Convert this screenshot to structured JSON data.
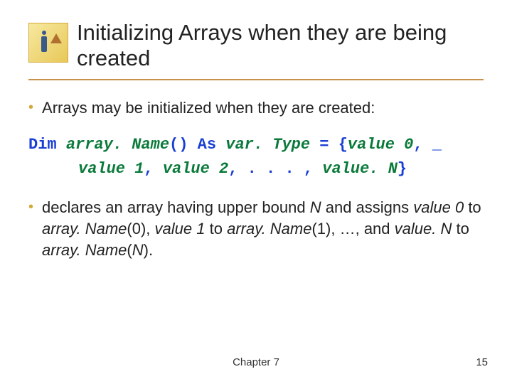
{
  "header": {
    "title": "Initializing Arrays when they are being created"
  },
  "bullets": {
    "intro": "Arrays may be initialized when they are created:",
    "desc_parts": {
      "p1": "declares an array having upper bound ",
      "n1": "N",
      "p2": " and assigns ",
      "v0": "value 0",
      "p3": " to ",
      "a0a": "array. Name",
      "a0b": "(0), ",
      "v1": "value 1",
      "p4": " to ",
      "a1a": "array. Name",
      "a1b": "(1), …, and ",
      "vn": "value. N",
      "p5": " to ",
      "ana": "array. Name",
      "anb": "(",
      "n2": "N",
      "p6": ")."
    }
  },
  "code": {
    "dim": "Dim ",
    "arrname": "array. Name",
    "paren": "() ",
    "as": "As ",
    "vartype": "var. Type",
    "eq": " = {",
    "v0": "value 0",
    "comma": ", ",
    "cont": "_",
    "v1": "value 1",
    "v2": "value 2",
    "dots": ". . . ",
    "vn": "value. N",
    "close": "}"
  },
  "footer": {
    "chapter": "Chapter 7",
    "page": "15"
  }
}
